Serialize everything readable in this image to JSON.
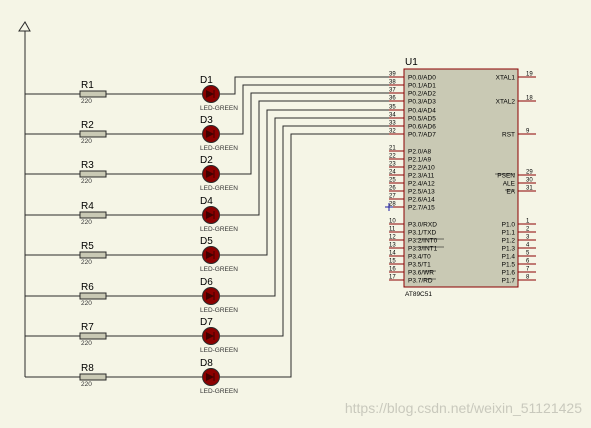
{
  "resistors": [
    {
      "ref": "R1",
      "value": "220"
    },
    {
      "ref": "R2",
      "value": "220"
    },
    {
      "ref": "R3",
      "value": "220"
    },
    {
      "ref": "R4",
      "value": "220"
    },
    {
      "ref": "R5",
      "value": "220"
    },
    {
      "ref": "R6",
      "value": "220"
    },
    {
      "ref": "R7",
      "value": "220"
    },
    {
      "ref": "R8",
      "value": "220"
    }
  ],
  "leds": [
    {
      "ref": "D1",
      "value": "LED-GREEN"
    },
    {
      "ref": "D3",
      "value": "LED-GREEN"
    },
    {
      "ref": "D2",
      "value": "LED-GREEN"
    },
    {
      "ref": "D4",
      "value": "LED-GREEN"
    },
    {
      "ref": "D5",
      "value": "LED-GREEN"
    },
    {
      "ref": "D6",
      "value": "LED-GREEN"
    },
    {
      "ref": "D7",
      "value": "LED-GREEN"
    },
    {
      "ref": "D8",
      "value": "LED-GREEN"
    }
  ],
  "chip": {
    "ref": "U1",
    "part": "AT89C51",
    "left_pins": [
      {
        "num": "39",
        "label": "P0.0/AD0"
      },
      {
        "num": "38",
        "label": "P0.1/AD1"
      },
      {
        "num": "37",
        "label": "P0.2/AD2"
      },
      {
        "num": "36",
        "label": "P0.3/AD3"
      },
      {
        "num": "35",
        "label": "P0.4/AD4"
      },
      {
        "num": "34",
        "label": "P0.5/AD5"
      },
      {
        "num": "33",
        "label": "P0.6/AD6"
      },
      {
        "num": "32",
        "label": "P0.7/AD7"
      },
      {
        "num": "21",
        "label": "P2.0/A8"
      },
      {
        "num": "22",
        "label": "P2.1/A9"
      },
      {
        "num": "23",
        "label": "P2.2/A10"
      },
      {
        "num": "24",
        "label": "P2.3/A11"
      },
      {
        "num": "25",
        "label": "P2.4/A12"
      },
      {
        "num": "26",
        "label": "P2.5/A13"
      },
      {
        "num": "27",
        "label": "P2.6/A14"
      },
      {
        "num": "28",
        "label": "P2.7/A15"
      },
      {
        "num": "10",
        "label": "P3.0/RXD"
      },
      {
        "num": "11",
        "label": "P3.1/TXD"
      },
      {
        "num": "12",
        "label": "P3.2/INT0"
      },
      {
        "num": "13",
        "label": "P3.3/INT1"
      },
      {
        "num": "14",
        "label": "P3.4/T0"
      },
      {
        "num": "15",
        "label": "P3.5/T1"
      },
      {
        "num": "16",
        "label": "P3.6/WR"
      },
      {
        "num": "17",
        "label": "P3.7/RD"
      }
    ],
    "right_pins": [
      {
        "num": "19",
        "label": "XTAL1"
      },
      {
        "num": "18",
        "label": "XTAL2"
      },
      {
        "num": "9",
        "label": "RST"
      },
      {
        "num": "29",
        "label": "PSEN"
      },
      {
        "num": "30",
        "label": "ALE"
      },
      {
        "num": "31",
        "label": "EA"
      },
      {
        "num": "1",
        "label": "P1.0"
      },
      {
        "num": "2",
        "label": "P1.1"
      },
      {
        "num": "3",
        "label": "P1.2"
      },
      {
        "num": "4",
        "label": "P1.3"
      },
      {
        "num": "5",
        "label": "P1.4"
      },
      {
        "num": "6",
        "label": "P1.5"
      },
      {
        "num": "7",
        "label": "P1.6"
      },
      {
        "num": "8",
        "label": "P1.7"
      }
    ]
  },
  "watermark": "https://blog.csdn.net/weixin_51121425",
  "colors": {
    "background": "#f5f5e6",
    "wire": "#2a2a2a",
    "pin": "#8b0000",
    "chip_fill": "#c9c9b4",
    "resistor_fill": "#c9c9b4",
    "led_fill": "#8b0000"
  }
}
